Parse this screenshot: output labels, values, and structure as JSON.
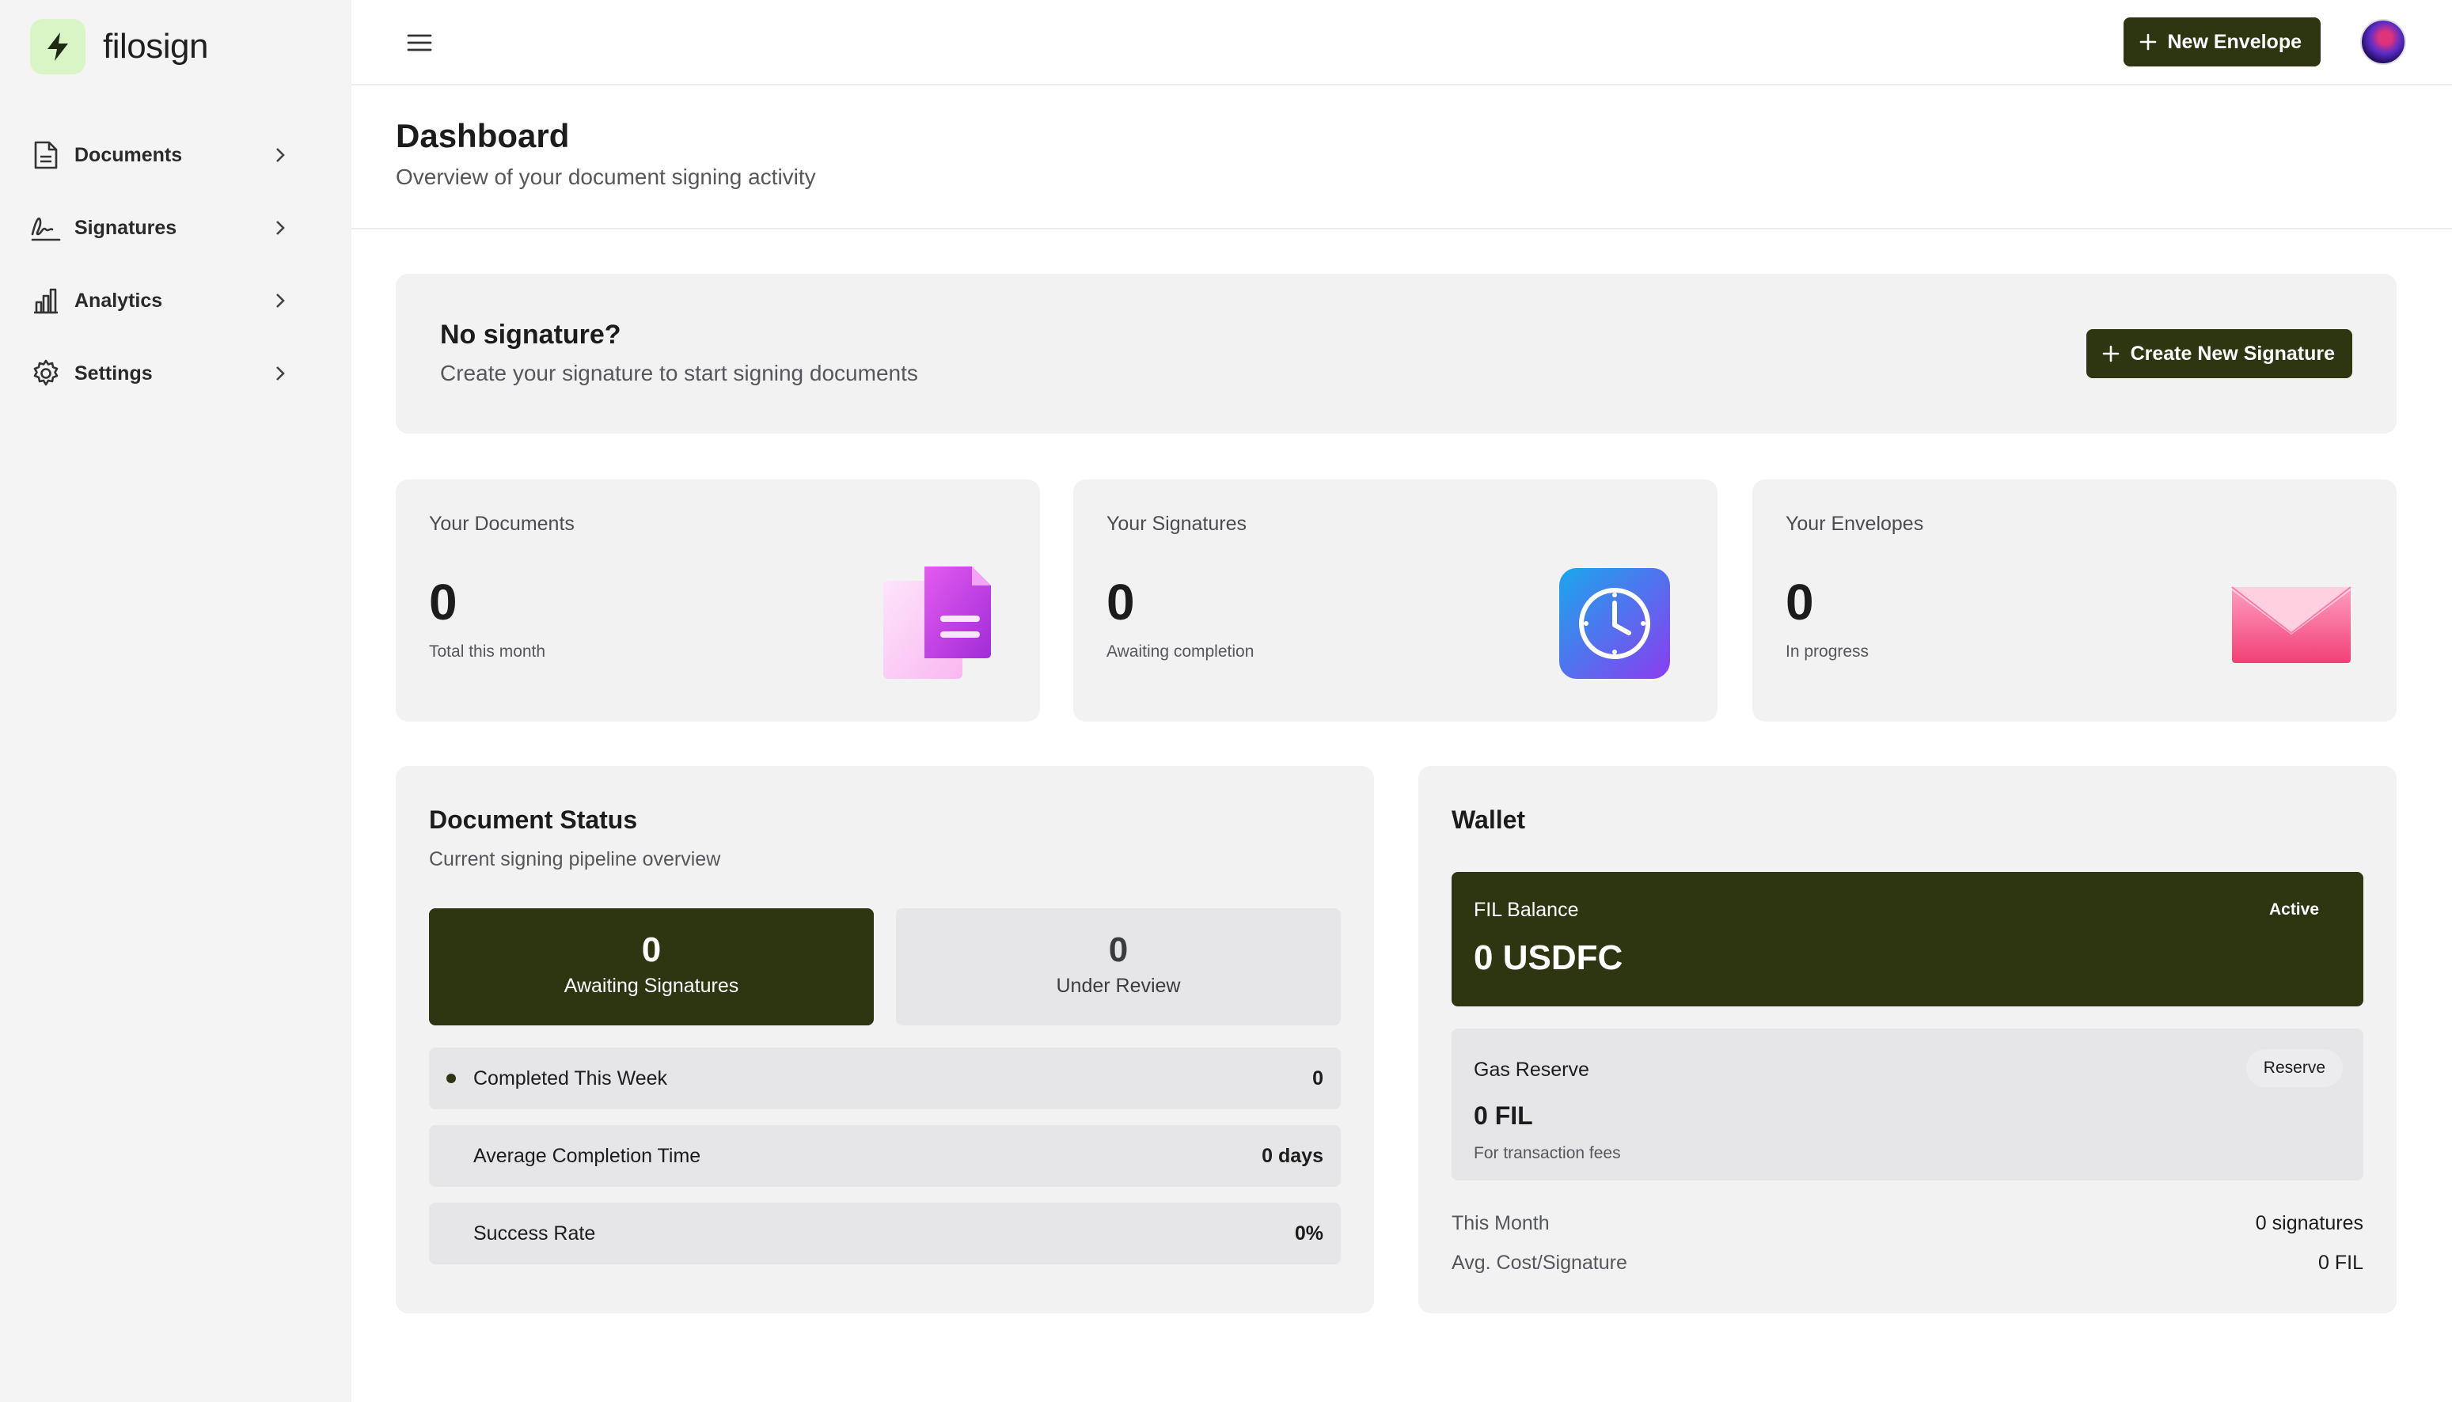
{
  "app": {
    "name": "filosign",
    "brand_color": "#2d3511",
    "logo_bg": "#d9f5c5"
  },
  "sidebar": {
    "items": [
      {
        "label": "Documents",
        "icon": "document-icon"
      },
      {
        "label": "Signatures",
        "icon": "signature-icon"
      },
      {
        "label": "Analytics",
        "icon": "bar-chart-icon"
      },
      {
        "label": "Settings",
        "icon": "gear-icon"
      }
    ]
  },
  "topbar": {
    "new_envelope_label": "New Envelope"
  },
  "header": {
    "title": "Dashboard",
    "subtitle": "Overview of your document signing activity"
  },
  "banner": {
    "title": "No signature?",
    "subtitle": "Create your signature to start signing documents",
    "button_label": "Create New Signature"
  },
  "stats": [
    {
      "label": "Your Documents",
      "value": "0",
      "sub": "Total this month",
      "icon": "documents-illustration"
    },
    {
      "label": "Your Signatures",
      "value": "0",
      "sub": "Awaiting completion",
      "icon": "clock-illustration"
    },
    {
      "label": "Your Envelopes",
      "value": "0",
      "sub": "In progress",
      "icon": "envelope-illustration"
    }
  ],
  "document_status": {
    "title": "Document Status",
    "subtitle": "Current signing pipeline overview",
    "tiles": [
      {
        "value": "0",
        "label": "Awaiting Signatures"
      },
      {
        "value": "0",
        "label": "Under Review"
      }
    ],
    "metrics": [
      {
        "label": "Completed This Week",
        "value": "0"
      },
      {
        "label": "Average Completion Time",
        "value": "0 days"
      },
      {
        "label": "Success Rate",
        "value": "0%"
      }
    ]
  },
  "wallet": {
    "title": "Wallet",
    "fil_balance": {
      "label": "FIL Balance",
      "value": "0 USDFC",
      "badge": "Active"
    },
    "gas_reserve": {
      "label": "Gas Reserve",
      "value": "0 FIL",
      "sub": "For transaction fees",
      "badge": "Reserve"
    },
    "rows": [
      {
        "label": "This Month",
        "value": "0 signatures"
      },
      {
        "label": "Avg. Cost/Signature",
        "value": "0 FIL"
      }
    ]
  }
}
